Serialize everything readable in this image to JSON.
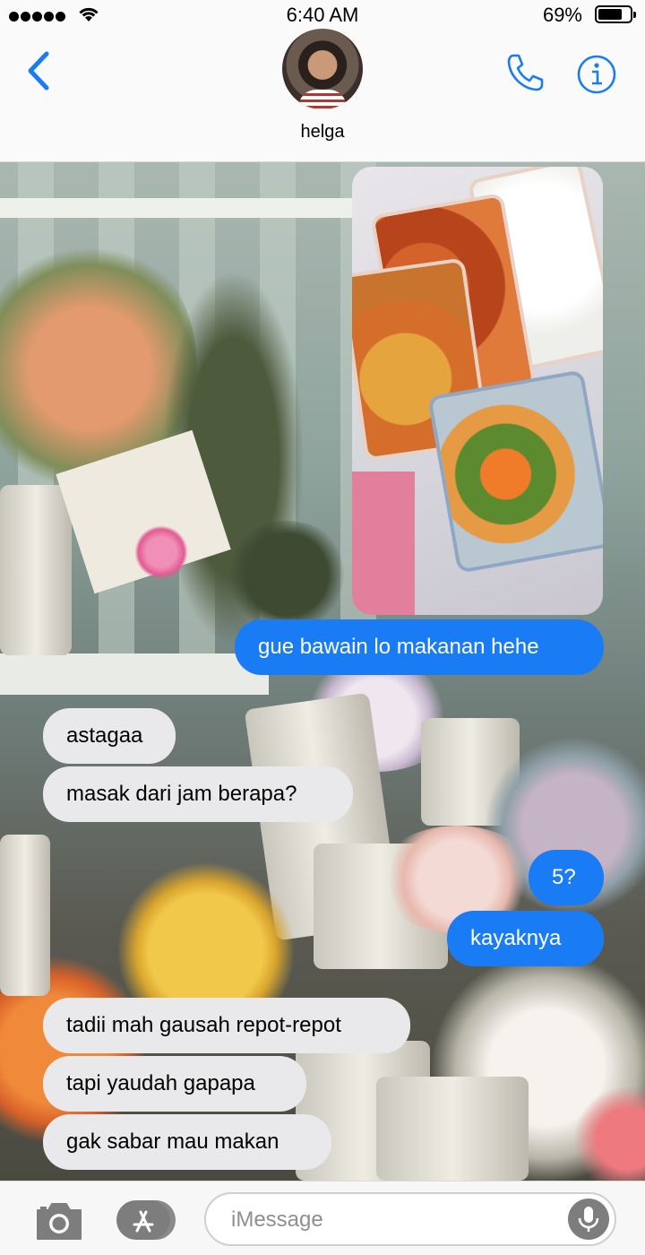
{
  "status_bar": {
    "time": "6:40 AM",
    "battery": "69%"
  },
  "header": {
    "contact_name": "helga"
  },
  "messages": [
    {
      "text": "gue bawain lo makanan hehe",
      "direction": "outgoing"
    },
    {
      "text": "astagaa",
      "direction": "incoming"
    },
    {
      "text": "masak dari jam berapa?",
      "direction": "incoming"
    },
    {
      "text": "5?",
      "direction": "outgoing"
    },
    {
      "text": "kayaknya",
      "direction": "outgoing"
    },
    {
      "text": "tadii mah gausah repot-repot",
      "direction": "incoming"
    },
    {
      "text": "tapi yaudah gapapa",
      "direction": "incoming"
    },
    {
      "text": "gak sabar mau makan",
      "direction": "incoming"
    }
  ],
  "input": {
    "placeholder": "iMessage"
  },
  "colors": {
    "accent": "#1a7cf5",
    "incoming_bubble": "#e9e9eb"
  },
  "icons": [
    "back-chevron-icon",
    "phone-icon",
    "info-icon",
    "camera-icon",
    "app-store-icon",
    "microphone-icon",
    "wifi-icon",
    "battery-icon"
  ]
}
